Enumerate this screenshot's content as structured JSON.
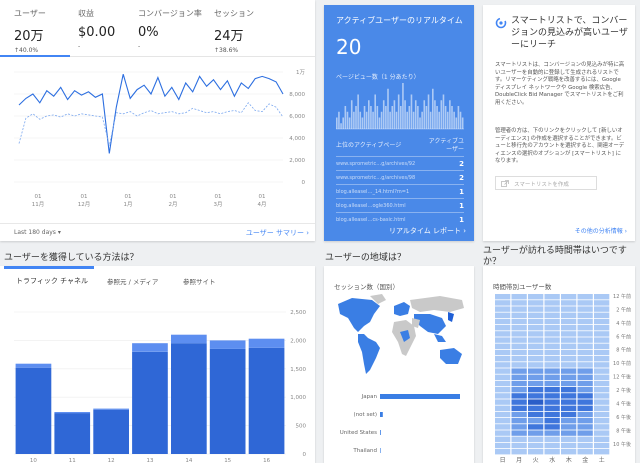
{
  "overview": {
    "metrics": [
      {
        "label": "ユーザー",
        "value": "20万",
        "change": "↑40.0%",
        "active": true
      },
      {
        "label": "収益",
        "value": "$0.00",
        "change": "-",
        "active": false
      },
      {
        "label": "コンバージョン率",
        "value": "0%",
        "change": "-",
        "active": false
      },
      {
        "label": "セッション",
        "value": "24万",
        "change": "↑38.6%",
        "active": false
      }
    ],
    "date_range": "Last 180 days ▾",
    "footer_link": "ユーザー サマリー  ›"
  },
  "overview_chart": {
    "type": "line",
    "y_ticks": [
      "1万",
      "8,000",
      "6,000",
      "4,000",
      "2,000",
      "0"
    ],
    "ylim": [
      0,
      10000
    ],
    "x_ticks": [
      {
        "top": "01",
        "bottom": "11月"
      },
      {
        "top": "01",
        "bottom": "12月"
      },
      {
        "top": "01",
        "bottom": "1月"
      },
      {
        "top": "01",
        "bottom": "2月"
      },
      {
        "top": "01",
        "bottom": "3月"
      },
      {
        "top": "01",
        "bottom": "4月"
      }
    ],
    "series": [
      {
        "style": "solid",
        "values": [
          7000,
          7600,
          8000,
          7200,
          8300,
          7800,
          8600,
          7500,
          8300,
          7900,
          8200,
          7700,
          8000,
          2600,
          6800,
          9800,
          7600,
          8400,
          8800,
          8000,
          9500,
          7800,
          8600,
          7500,
          9000,
          8200,
          9600,
          8700,
          9300,
          8400,
          9200,
          7800,
          9000,
          8500,
          9400,
          9600,
          9400,
          9100,
          8000
        ]
      },
      {
        "style": "dashed",
        "values": [
          3500,
          5800,
          6200,
          5700,
          6000,
          6100,
          5900,
          6200,
          6000,
          6200,
          6100,
          6000,
          5900,
          3300,
          6300,
          6200,
          6400,
          6000,
          6300,
          6500,
          6200,
          6300,
          6400,
          6200,
          6300,
          6700,
          6500,
          6300,
          6400,
          6200,
          6400,
          6500,
          6300,
          7200,
          6500,
          6400,
          7100,
          6800,
          5900
        ]
      }
    ]
  },
  "realtime": {
    "title": "アクティブユーザーのリアルタイム",
    "count": "20",
    "subtitle": "ページビュー数（1 分あたり）",
    "table_header_left": "上位のアクティブページ",
    "table_header_right_1": "アクティブユ",
    "table_header_right_2": "ーザー",
    "rows": [
      {
        "page": "www.sprometric…g/archives/92",
        "count": "2"
      },
      {
        "page": "www.sprometric…g/archives/98",
        "count": "2"
      },
      {
        "page": "blog.alleasel…_14.html?m=1",
        "count": "1"
      },
      {
        "page": "blog.alleasel…ogle360.html",
        "count": "1"
      },
      {
        "page": "blog.alleasel…cs-basic.html",
        "count": "1"
      }
    ],
    "footer": "リアルタイム レポート  ›",
    "bars": [
      2,
      3,
      1,
      2,
      4,
      3,
      2,
      5,
      3,
      4,
      6,
      3,
      2,
      4,
      3,
      5,
      4,
      3,
      6,
      4,
      2,
      3,
      5,
      4,
      7,
      3,
      4,
      5,
      3,
      6,
      4,
      8,
      5,
      3,
      4,
      6,
      3,
      5,
      4,
      2,
      3,
      5,
      4,
      6,
      3,
      7,
      5,
      4,
      3,
      5,
      6,
      4,
      3,
      5,
      4,
      3,
      2,
      4,
      3,
      2
    ]
  },
  "smartlist": {
    "title": "スマートリストで、コンバージョンの見込みが高いユーザーにリーチ",
    "para1": "スマートリストは、コンバージョンの見込みが特に高いユーザーを自動的に登録して生成されるリストです。リマーケティング戦略を改善するには、Google ディスプレイ ネットワークや Google 検索広告、DoubleClick Bid Manager でスマートリストをご利用ください。",
    "para2": "管理者の方は、下のリンクをクリックして [新しいオーディエンス] の作成を選択することができます。ビューと移行先のアカウントを選択すると、関連オーディエンスの選択のオプションが [スマートリスト] になります。",
    "button": "スマートリストを作成",
    "footer": "その他の分析情報  ›"
  },
  "sections": {
    "acquisition": "ユーザーを獲得している方法は？",
    "geo": "ユーザーの地域は？",
    "time": "ユーザーが訪れる時間帯はいつですか？"
  },
  "acquisition": {
    "tabs": [
      "トラフィック チャネル",
      "参照元 / メディア",
      "参照サイト"
    ]
  },
  "acq_chart": {
    "type": "bar",
    "categories": [
      "10",
      "11",
      "12",
      "13",
      "14",
      "15",
      "16"
    ],
    "stacks": [
      [
        1520,
        70
      ],
      [
        720,
        20
      ],
      [
        780,
        20
      ],
      [
        1800,
        150
      ],
      [
        1950,
        150
      ],
      [
        1850,
        150
      ],
      [
        1870,
        160
      ]
    ],
    "y_ticks": [
      "2,500",
      "2,000",
      "1,500",
      "1,000",
      "500",
      "0"
    ],
    "ylim": [
      0,
      2500
    ]
  },
  "geo": {
    "title": "セッション数（国別）",
    "countries": [
      "Japan",
      "(not set)",
      "United States",
      "Thailand"
    ],
    "values": [
      1.0,
      0.035,
      0.01,
      0.005
    ]
  },
  "heatmap": {
    "title": "時間帯別ユーザー数",
    "hour_labels": [
      "12 午前",
      "2 午前",
      "4 午前",
      "6 午前",
      "8 午前",
      "10 午前",
      "12 午後",
      "2 午後",
      "4 午後",
      "6 午後",
      "8 午後",
      "10 午後"
    ],
    "day_labels": [
      "日",
      "月",
      "火",
      "水",
      "木",
      "金",
      "土"
    ],
    "intensity": [
      [
        1,
        1,
        1,
        1,
        1,
        1,
        1
      ],
      [
        1,
        1,
        1,
        1,
        1,
        1,
        1
      ],
      [
        1,
        1,
        1,
        1,
        1,
        1,
        1
      ],
      [
        1,
        1,
        1,
        1,
        1,
        1,
        1
      ],
      [
        1,
        1,
        1,
        1,
        1,
        1,
        1
      ],
      [
        1,
        1,
        1,
        1,
        1,
        1,
        1
      ],
      [
        1,
        1,
        1,
        1,
        1,
        1,
        1
      ],
      [
        1,
        1,
        1,
        1,
        1,
        1,
        1
      ],
      [
        1,
        1,
        1,
        1,
        1,
        1,
        1
      ],
      [
        1,
        1,
        1,
        1,
        1,
        1,
        1
      ],
      [
        1,
        1,
        1,
        1,
        1,
        1,
        1
      ],
      [
        1,
        1,
        1,
        1,
        1,
        1,
        1
      ],
      [
        1,
        2,
        2,
        2,
        2,
        2,
        1
      ],
      [
        1,
        2,
        2,
        2,
        2,
        2,
        1
      ],
      [
        1,
        2,
        2,
        2,
        2,
        2,
        1
      ],
      [
        1,
        2,
        3,
        3,
        3,
        2,
        1
      ],
      [
        1,
        3,
        3,
        3,
        3,
        3,
        1
      ],
      [
        1,
        3,
        4,
        3,
        3,
        3,
        1
      ],
      [
        1,
        3,
        3,
        3,
        3,
        3,
        1
      ],
      [
        1,
        2,
        3,
        3,
        3,
        2,
        1
      ],
      [
        1,
        2,
        2,
        3,
        2,
        2,
        1
      ],
      [
        1,
        2,
        3,
        3,
        2,
        2,
        1
      ],
      [
        1,
        2,
        2,
        2,
        2,
        2,
        1
      ],
      [
        1,
        1,
        1,
        1,
        1,
        1,
        1
      ],
      [
        1,
        1,
        1,
        1,
        1,
        1,
        1
      ],
      [
        1,
        1,
        1,
        1,
        1,
        1,
        1
      ]
    ]
  }
}
